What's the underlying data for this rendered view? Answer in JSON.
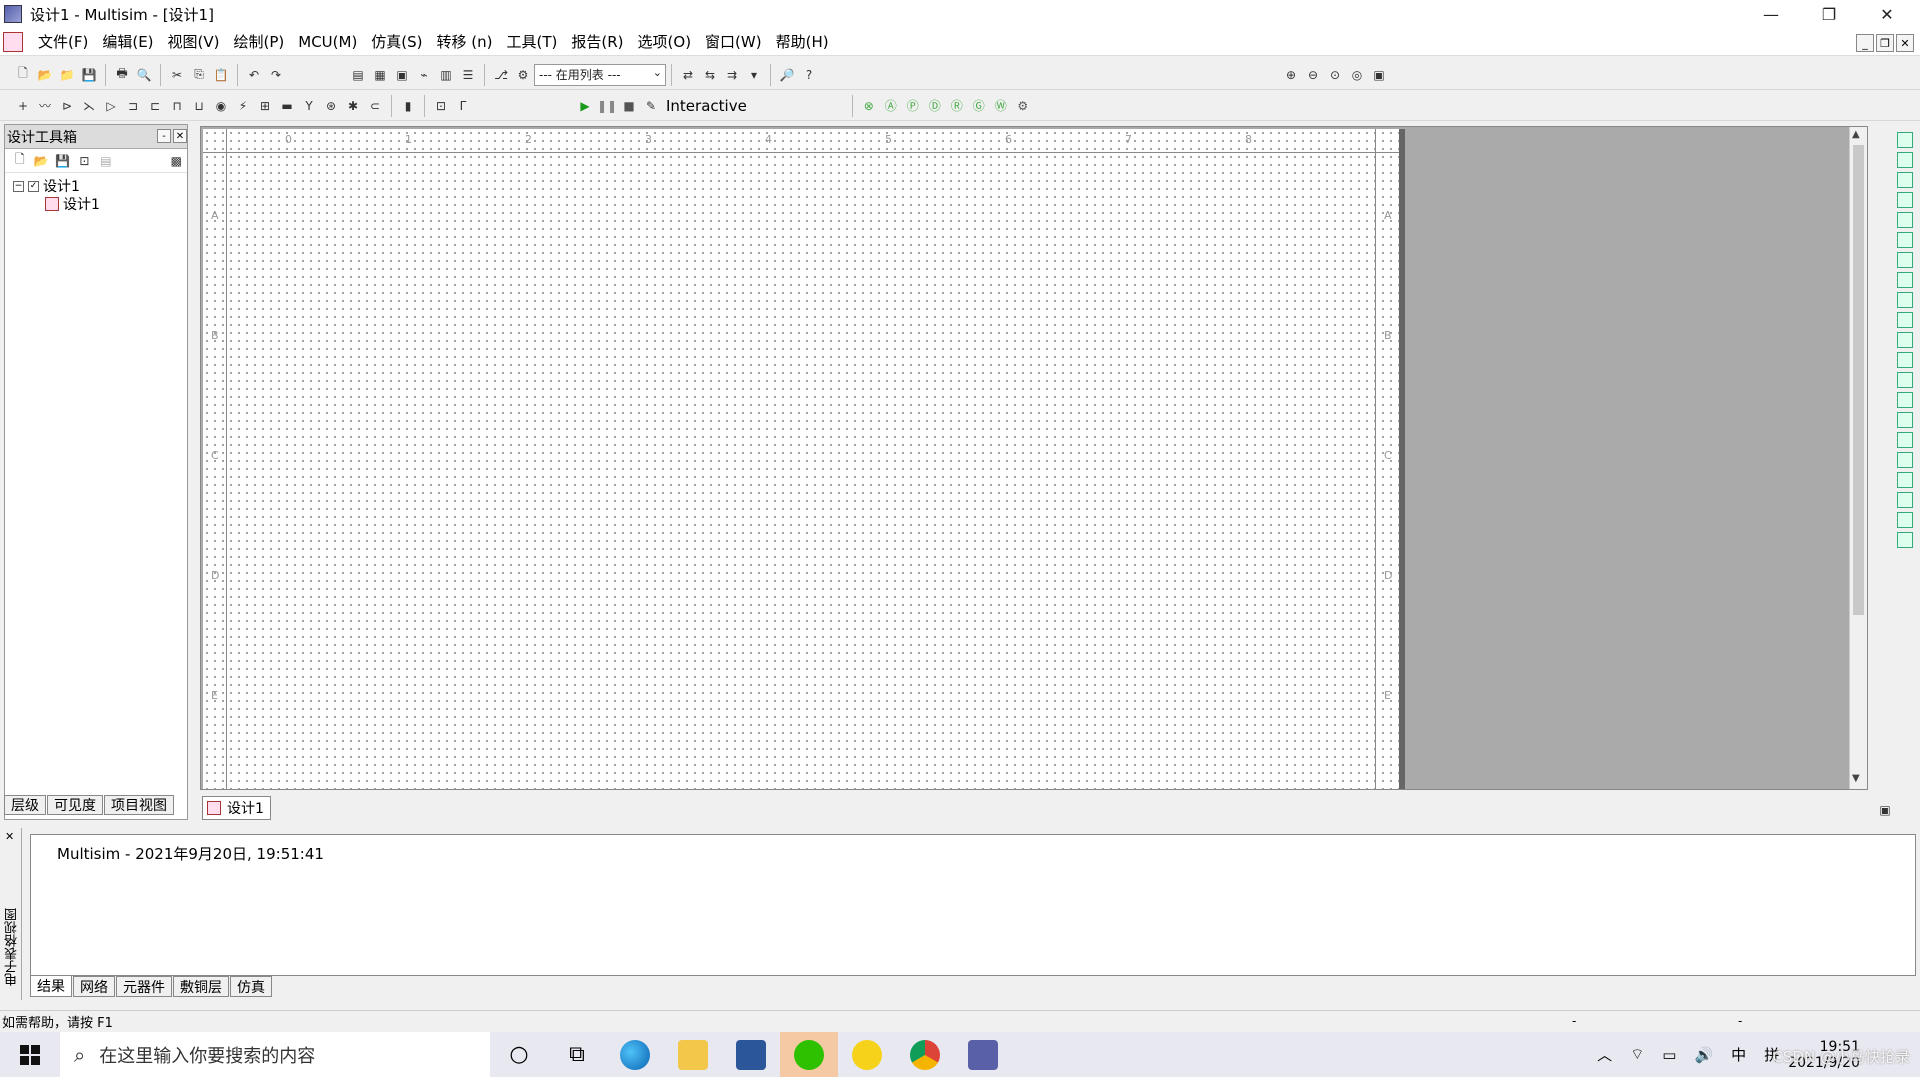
{
  "window": {
    "title": "设计1 - Multisim - [设计1]",
    "minimize": "—",
    "restore": "❐",
    "close": "✕"
  },
  "menu": [
    "文件(F)",
    "编辑(E)",
    "视图(V)",
    "绘制(P)",
    "MCU(M)",
    "仿真(S)",
    "转移 (n)",
    "工具(T)",
    "报告(R)",
    "选项(O)",
    "窗口(W)",
    "帮助(H)"
  ],
  "toolbar": {
    "inuse_combo": "--- 在用列表 ---",
    "sim_mode": "Interactive"
  },
  "design_toolbox": {
    "title": "设计工具箱",
    "tree_root": "设计1",
    "tree_child": "设计1",
    "tabs": [
      "层级",
      "可见度",
      "项目视图"
    ]
  },
  "canvas": {
    "col_labels": [
      "0",
      "1",
      "2",
      "3",
      "4",
      "5",
      "6",
      "7",
      "8"
    ],
    "row_labels": [
      "A",
      "B",
      "C",
      "D",
      "E"
    ]
  },
  "design_tab": "设计1",
  "spreadsheet": {
    "side_title": "电子表格视图",
    "log_line": "Multisim  -  2021年9月20日, 19:51:41",
    "tabs": [
      "结果",
      "网络",
      "元器件",
      "敷铜层",
      "仿真"
    ]
  },
  "status": {
    "help_text": "如需帮助，请按 F1",
    "cell1": "-",
    "cell2": "-"
  },
  "taskbar": {
    "search_placeholder": "在这里输入你要搜索的内容",
    "tray_ime": "中",
    "tray_ime2": "拼",
    "time": "19:51",
    "date": "2021/9/20",
    "watermark": "CSDN @小马快抢录"
  }
}
